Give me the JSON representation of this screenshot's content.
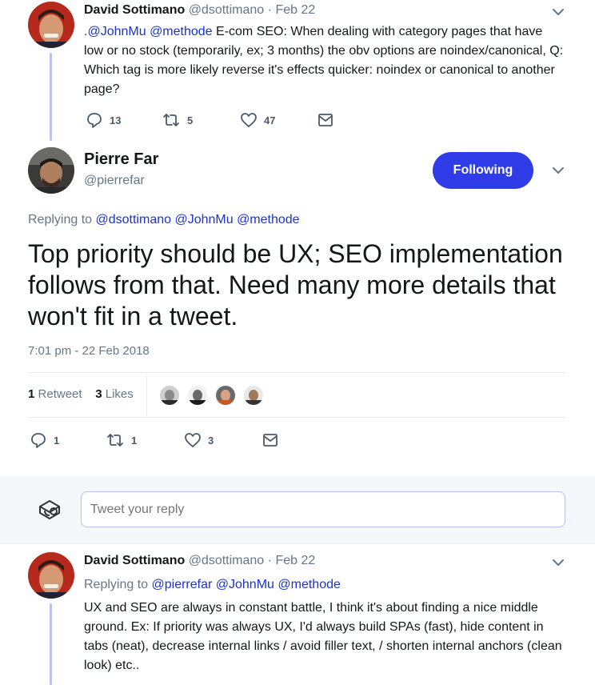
{
  "tweet1": {
    "name": "David Sottimano",
    "handle": "@dsottimano",
    "sep": "·",
    "date": "Feb 22",
    "mention1": ".@JohnMu",
    "mention2": "@methode",
    "text_rest": " E-com SEO: When dealing with category pages that have low or no stock (temporarily, ex; 3 months) the obv options are noindex/canonical, Q: Which tag is more likely reverse it's effects quicker: noindex or canonical to another page?",
    "replies": "13",
    "retweets": "5",
    "likes": "47"
  },
  "main_tweet": {
    "name": "Pierre Far",
    "handle": "@pierrefar",
    "follow_label": "Following",
    "replying_label": "Replying to",
    "replying_mentions": "@dsottimano @JohnMu @methode",
    "text": "Top priority should be UX; SEO implementation follows from that. Need many more details that won't fit in a tweet.",
    "timestamp": "7:01 pm - 22 Feb 2018",
    "retweet_count": "1",
    "retweet_label": "Retweet",
    "like_count": "3",
    "like_label": "Likes",
    "replies": "1",
    "retweets": "1",
    "likes": "3"
  },
  "reply_box": {
    "placeholder": "Tweet your reply"
  },
  "tweet3": {
    "name": "David Sottimano",
    "handle": "@dsottimano",
    "sep": "·",
    "date": "Feb 22",
    "replying_label": "Replying to",
    "replying_mentions": "@pierrefar @JohnMu @methode",
    "text": "UX and SEO are always in constant battle, I think it's about finding a nice middle ground.  Ex: If priority was always UX, I'd always build SPAs (fast), hide content in tabs (neat), decrease internal links / avoid filler text, / shorten internal anchors (clean look) etc.."
  },
  "colors": {
    "accent": "#2f3ce8",
    "mention": "#1b33c9",
    "muted": "#657786",
    "thread_line": "#b7c6f2"
  }
}
